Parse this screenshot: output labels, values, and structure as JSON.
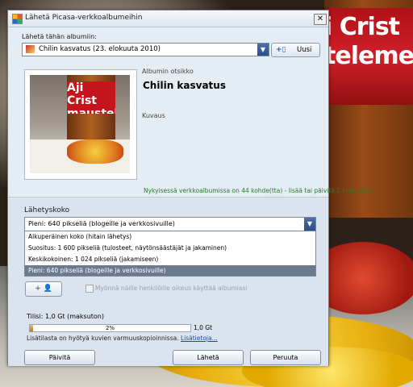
{
  "dialog": {
    "title": "Lähetä Picasa-verkkoalbumeihin",
    "close": "✕"
  },
  "album": {
    "send_label": "Lähetä tähän albumiin:",
    "selected": "Chilin kasvatus (23. elokuuta 2010)",
    "new_button": "Uusi",
    "title_label": "Albumin otsikko",
    "title_value": "Chilin kasvatus",
    "description_label": "Kuvaus",
    "info": "Nykyisessä verkkoalbumissa on 44 kohde(tta) - lisää tai päivitä 1 kohde(tta)"
  },
  "photo": {
    "label_text": "Aji Crist maustekast"
  },
  "upload_size": {
    "label": "Lähetyskoko",
    "selected": "Pieni: 640 pikseliä (blogeille ja verkkosivuille)",
    "options": [
      "Alkuperäinen koko (hitain lähetys)",
      "Suositus: 1 600 pikseliä (tulosteet, näytönsäästäjät ja jakaminen)",
      "Keskikokoinen: 1 024 pikseliä (jakamiseen)",
      "Pieni: 640 pikseliä (blogeille ja verkkosivuille)"
    ],
    "selected_index": 3
  },
  "sharing": {
    "add_button": "+ 👤",
    "checkbox_label": "Myönnä näille henkilöille oikeus käyttää albumiasi"
  },
  "quota": {
    "label": "Tilisi:  1,0 Gt  (maksuton)",
    "percent_text": "2%",
    "fraction": 0.02,
    "max": "1,0 Gt",
    "more_text": "Lisätilasta on hyötyä kuvien varmuuskopioinnissa.",
    "more_link": "Lisätietoja..."
  },
  "buttons": {
    "upgrade": "Päivitä",
    "send": "Lähetä",
    "cancel": "Peruuta"
  },
  "background": {
    "jar_text_1": "i Crist",
    "jar_text_2": "teleme"
  }
}
